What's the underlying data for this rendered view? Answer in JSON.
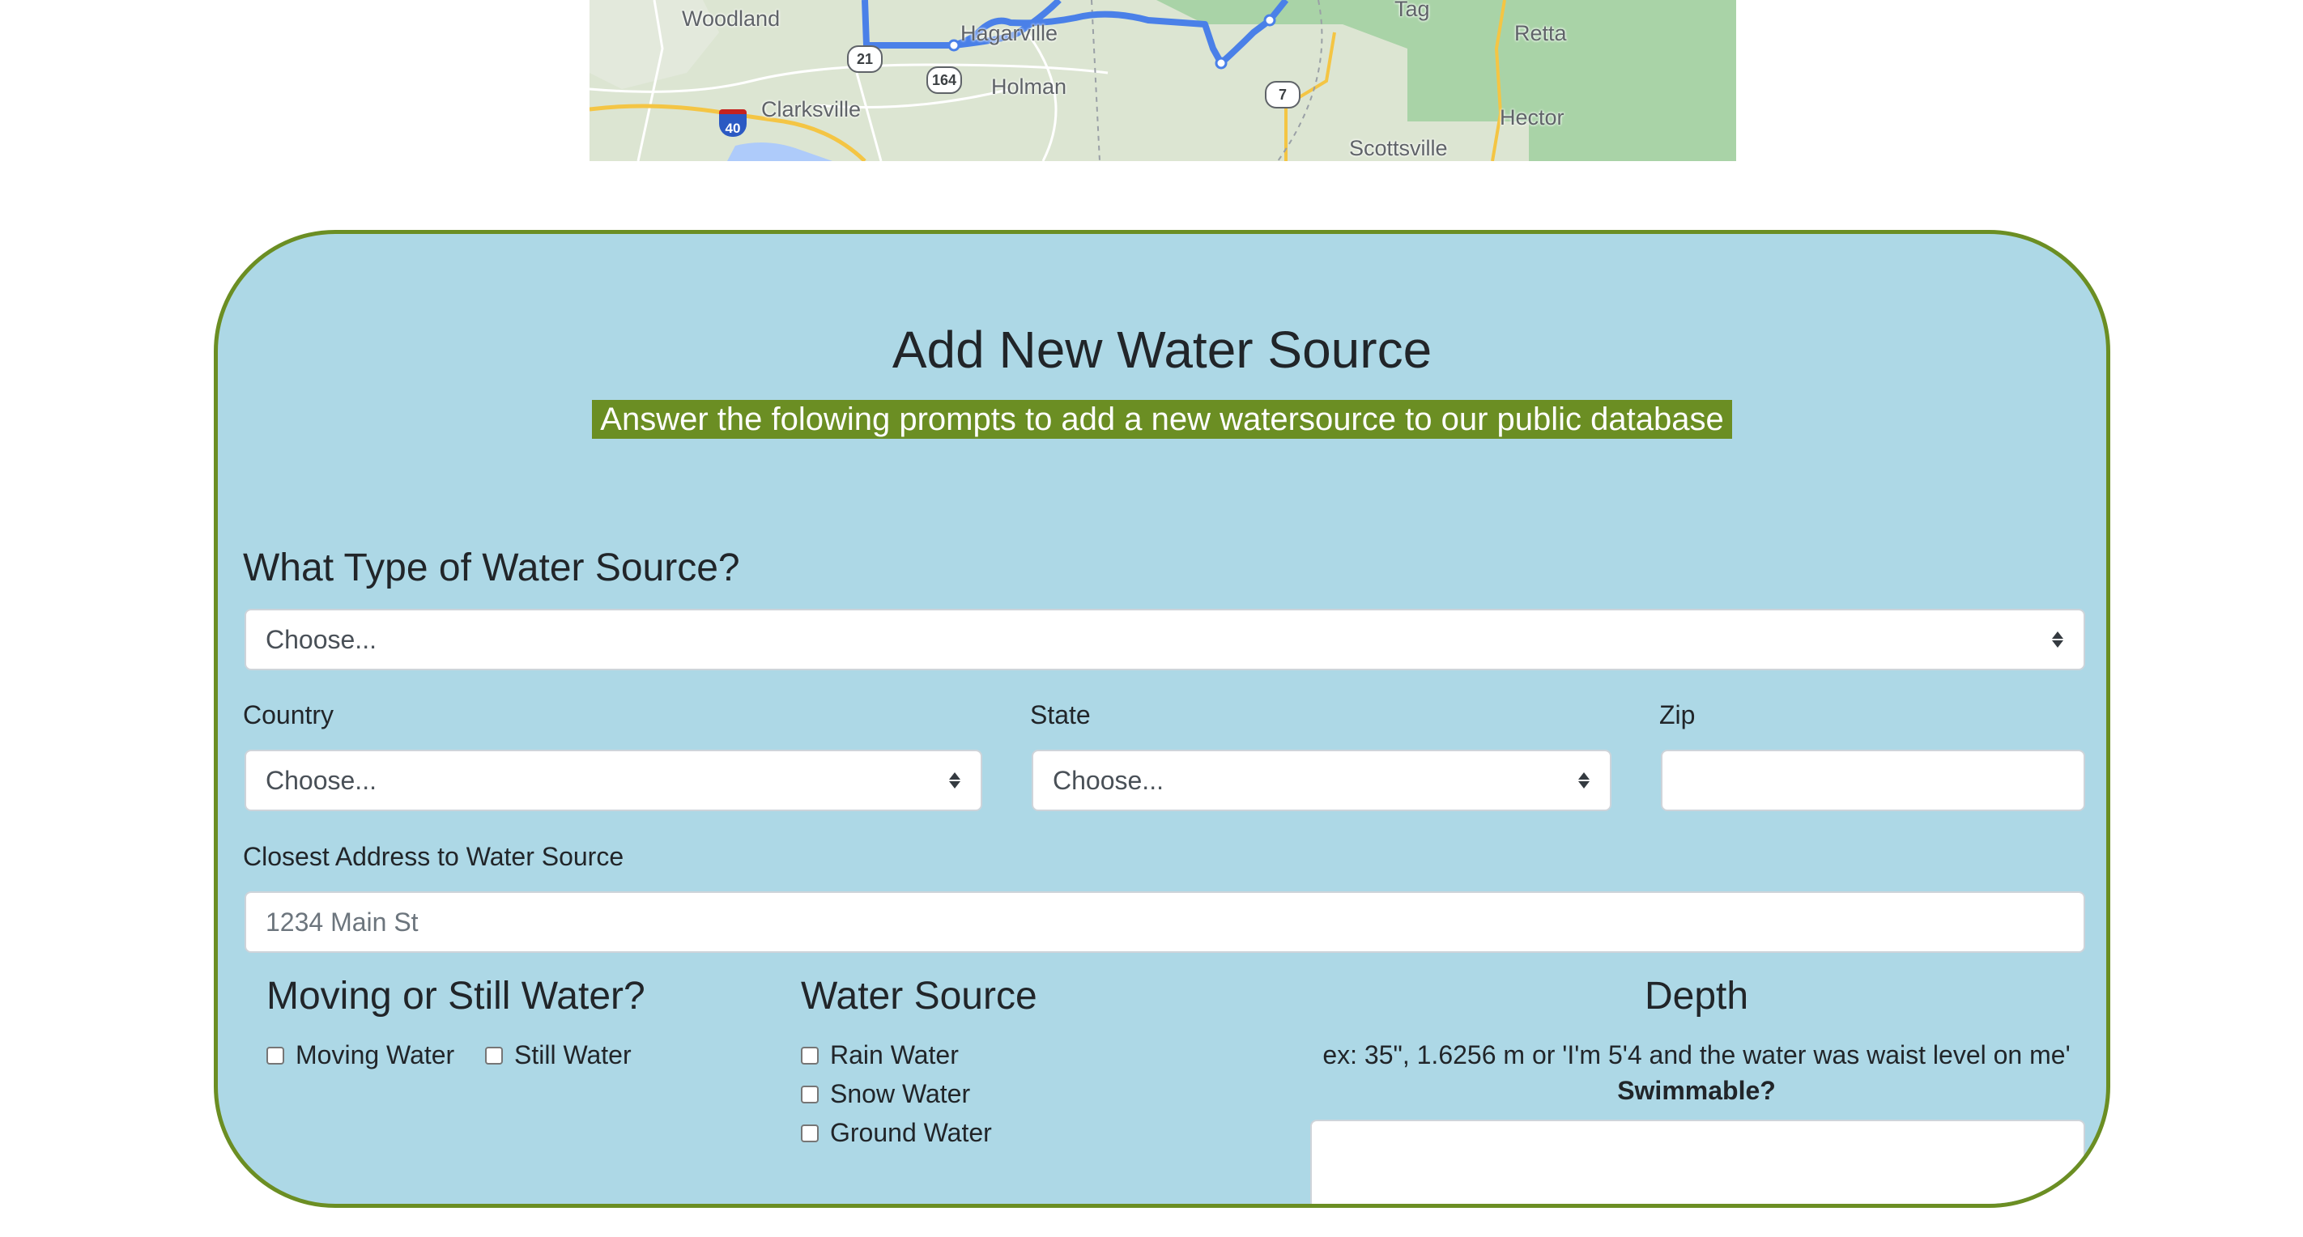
{
  "map": {
    "labels": {
      "woodland": "Woodland",
      "hagarville": "Hagarville",
      "holman": "Holman",
      "clarksville": "Clarksville",
      "tag": "Tag",
      "retta": "Retta",
      "hector": "Hector",
      "scottsville": "Scottsville"
    },
    "shields": {
      "r21": "21",
      "r164": "164",
      "r7": "7",
      "i40": "40"
    }
  },
  "form": {
    "title": "Add New Water Source",
    "subtitle": "Answer the folowing prompts to add a new watersource to our public database",
    "type_heading": "What Type of Water Source?",
    "type_select": "Choose...",
    "country_label": "Country",
    "country_select": "Choose...",
    "state_label": "State",
    "state_select": "Choose...",
    "zip_label": "Zip",
    "zip_value": "",
    "address_label": "Closest Address to Water Source",
    "address_placeholder": "1234 Main St",
    "moving_heading": "Moving or Still Water?",
    "moving_options": [
      "Moving Water",
      "Still Water"
    ],
    "source_heading": "Water Source",
    "source_options": [
      "Rain Water",
      "Snow Water",
      "Ground Water"
    ],
    "depth_heading": "Depth",
    "depth_hint": "ex: 35\", 1.6256 m or 'I'm 5'4 and the water was waist level on me'",
    "swimmable_label": "Swimmable?"
  },
  "colors": {
    "card_bg": "#add8e6",
    "card_border": "#6b8e23",
    "subtitle_bg": "#6b8e23",
    "route": "#4a80e8"
  }
}
